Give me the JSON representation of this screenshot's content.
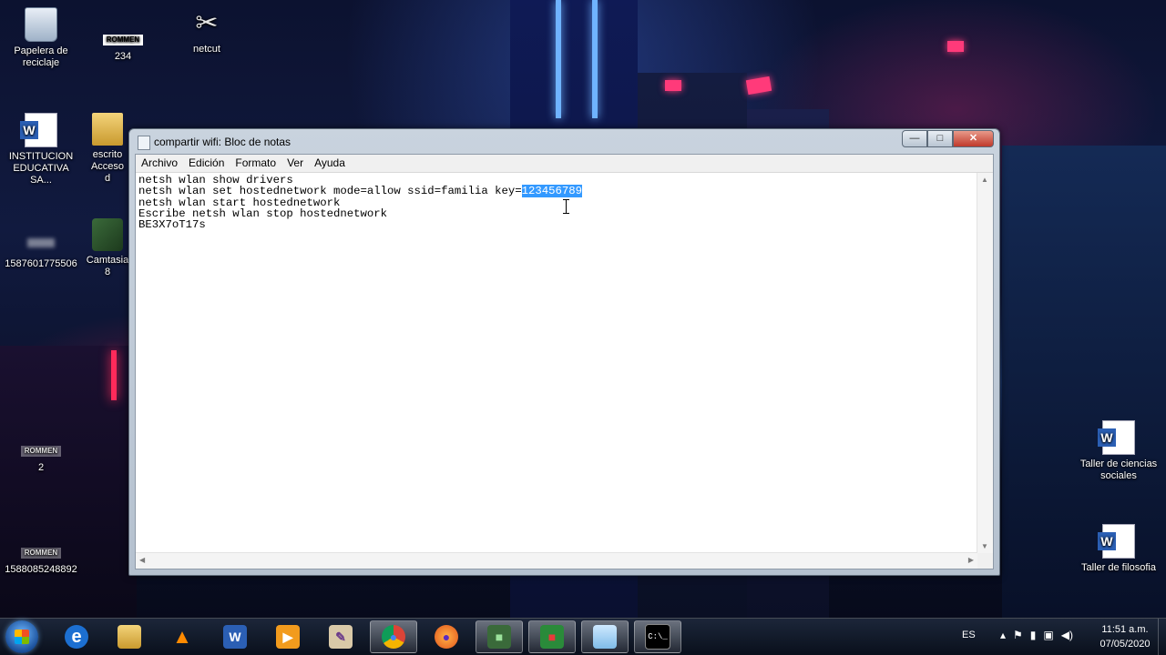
{
  "desktop": {
    "icons": [
      {
        "label": "Papelera de\nreciclaje"
      },
      {
        "label": "234",
        "badge": "ROMMEN"
      },
      {
        "label": "netcut"
      },
      {
        "label": "INSTITUCION EDUCATIVA SA..."
      },
      {
        "label": "escrito\nAcceso d"
      },
      {
        "label": "1587601775506"
      },
      {
        "label": "Camtasia\n8"
      },
      {
        "label": "2",
        "badge": "ROMMEN"
      },
      {
        "label": "1588085248892",
        "badge": "ROMMEN"
      },
      {
        "label": "Taller de ciencias sociales"
      },
      {
        "label": "Taller de filosofia"
      }
    ]
  },
  "notepad": {
    "title": "compartir wifi: Bloc de notas",
    "buttons": {
      "minimize": "—",
      "maximize": "□",
      "close": "✕"
    },
    "menu": [
      "Archivo",
      "Edición",
      "Formato",
      "Ver",
      "Ayuda"
    ],
    "lines": {
      "l1": "netsh wlan show drivers",
      "l2_prefix": "netsh wlan set hostednetwork mode=allow ssid=familia key=",
      "l2_selected": "123456789",
      "l3": "netsh wlan start hostednetwork",
      "l4": "Escribe netsh wlan stop hostednetwork",
      "l5": "BE3X7oT17s"
    },
    "selection_color": "#3399ff"
  },
  "taskbar": {
    "items": [
      {
        "icon": "internet-explorer-icon",
        "glyph": "e"
      },
      {
        "icon": "file-explorer-icon",
        "glyph": ""
      },
      {
        "icon": "vlc-icon",
        "glyph": "▲"
      },
      {
        "icon": "word-icon",
        "glyph": "W"
      },
      {
        "icon": "media-player-icon",
        "glyph": "▶"
      },
      {
        "icon": "paint-icon",
        "glyph": "✎"
      },
      {
        "icon": "chrome-icon",
        "glyph": "●"
      },
      {
        "icon": "firefox-icon",
        "glyph": "●"
      },
      {
        "icon": "camtasia-icon",
        "glyph": "■"
      },
      {
        "icon": "camtasia-recorder-icon",
        "glyph": "■"
      },
      {
        "icon": "notepad-icon",
        "glyph": ""
      },
      {
        "icon": "cmd-icon",
        "glyph": "C:\\_"
      }
    ],
    "tray": {
      "language": "ES",
      "time": "11:51 a.m.",
      "date": "07/05/2020"
    }
  }
}
